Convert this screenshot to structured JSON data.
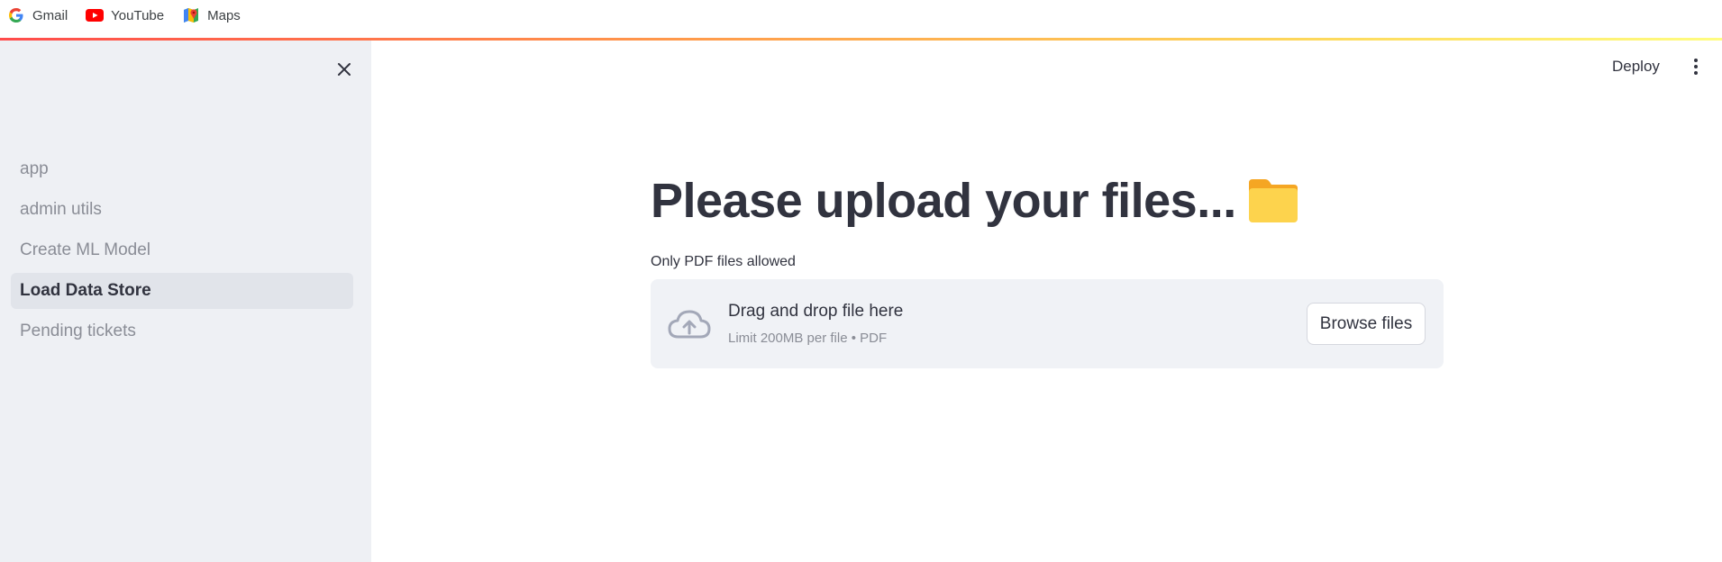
{
  "bookmarks": [
    {
      "label": "Gmail",
      "icon": "google-icon"
    },
    {
      "label": "YouTube",
      "icon": "youtube-icon"
    },
    {
      "label": "Maps",
      "icon": "maps-icon"
    }
  ],
  "sidebar": {
    "items": [
      {
        "label": "app",
        "active": false
      },
      {
        "label": "admin utils",
        "active": false
      },
      {
        "label": "Create ML Model",
        "active": false
      },
      {
        "label": "Load Data Store",
        "active": true
      },
      {
        "label": "Pending tickets",
        "active": false
      }
    ]
  },
  "header": {
    "deploy_label": "Deploy"
  },
  "main": {
    "title": "Please upload your files...",
    "title_icon": "folder-icon",
    "uploader": {
      "label": "Only PDF files allowed",
      "drop_title": "Drag and drop file here",
      "drop_subtitle": "Limit 200MB per file • PDF",
      "browse_label": "Browse files"
    }
  },
  "colors": {
    "sidebar_bg": "#eef0f4",
    "active_item_bg": "#e1e4ea",
    "dropzone_bg": "#f0f2f6",
    "text": "#31333f",
    "muted": "#8a8d96",
    "folder": "#fdd34d"
  }
}
